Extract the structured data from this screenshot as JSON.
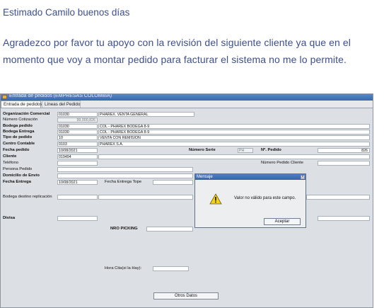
{
  "email": {
    "greeting": "Estimado Camilo buenos días",
    "line1": "Agradezco por favor tu apoyo con la revisión del siguiente cliente ya que en el",
    "line2": "momento que voy a montar pedido para facturar el sistema no me lo permite."
  },
  "window": {
    "title": "Entrada de pedidos (EMPRESAS COLOMBIA)",
    "tabs": [
      "Entrada de pedidos",
      "Líneas del Pedido"
    ]
  },
  "form": {
    "organizacion_label": "Organización Comercial",
    "organizacion_code": "01030",
    "organizacion_desc": "PHAREX.  VENTA GENERAL",
    "cotizacion_label": "Número Cotización",
    "cotizacion_value": "99,000,826",
    "bodega_pedido_label": "Bodega pedido",
    "bodega_pedido_code": "01030",
    "bodega_pedido_desc": "COL - PHAREX BODEGA 8-9",
    "bodega_entrega_label": "Bodega Entrega",
    "bodega_entrega_code": "01030",
    "bodega_entrega_desc": "COL - PHAREX BODEGA 8-9",
    "tipo_pedido_label": "Tipo de pedido",
    "tipo_pedido_code": "10",
    "tipo_pedido_desc": "VENTA CON REMISION",
    "centro_contable_label": "Centro Contable",
    "centro_contable_code": "0103",
    "centro_contable_desc": "PHAREX S.A.",
    "fecha_pedido_label": "Fecha  pedido",
    "fecha_pedido_value": "10/08/2021",
    "numero_serie_label": "Número Serie",
    "numero_serie_value": "PH",
    "numero_pedido_label": "Nº.  Pedido",
    "numero_pedido_value": "826",
    "cliente_label": "Cliente",
    "cliente_value": "019494",
    "telefono_label": "Teléfono",
    "numero_pedido_cliente_label": "Número Pedido Cliente",
    "persona_pedido_label": "Persona Pedido",
    "domicilio_label": "Domicilio de Envío",
    "fecha_entrega_label": "Fecha Entrega",
    "fecha_entrega_value": "10/08/2021",
    "fecha_entrega_tope_label": "Fecha Entrega Tope",
    "bodega_destino_label": "Bodega destino replicación",
    "divisa_label": "Divisa",
    "nro_picking_label": "NRO PICKING",
    "hora_cita_label": "Hora Cita(si la Hay):",
    "otros_datos_button": "Otros Datos"
  },
  "dialog": {
    "title": "Mensaje",
    "close": "X",
    "message": "Valor no válido para este campo.",
    "button": "Aceptar",
    "icon": "warning-icon"
  },
  "colors": {
    "email_text": "#3d4f8f",
    "titlebar": "#3a66b0",
    "window_bg": "#dcdfe3"
  }
}
